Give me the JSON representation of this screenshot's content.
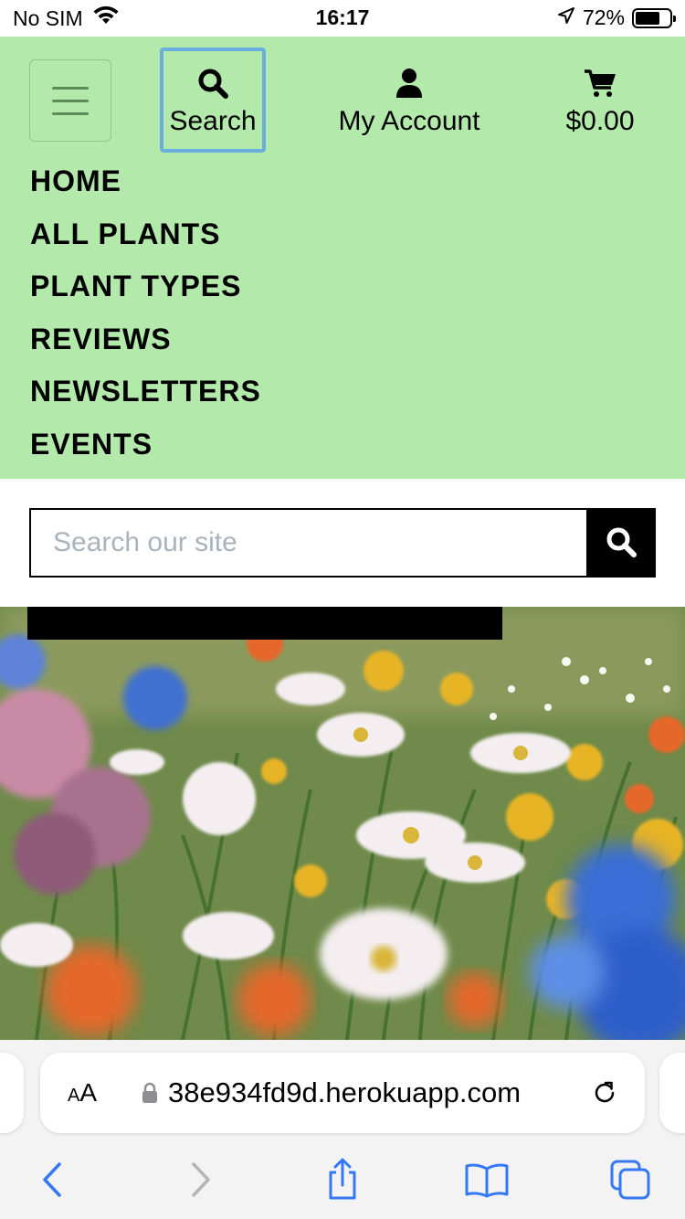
{
  "status_bar": {
    "carrier": "No SIM",
    "time": "16:17",
    "battery_percent": "72%",
    "battery_level": 0.72,
    "icons": [
      "wifi-icon",
      "location-arrow-icon",
      "battery-icon"
    ]
  },
  "header": {
    "background_color": "#b3e9aa",
    "search_label": "Search",
    "account_label": "My Account",
    "cart_total": "$0.00",
    "icons": [
      "hamburger-icon",
      "search-icon",
      "user-icon",
      "cart-icon"
    ]
  },
  "nav": {
    "items": [
      "HOME",
      "ALL PLANTS",
      "PLANT TYPES",
      "REVIEWS",
      "NEWSLETTERS",
      "EVENTS"
    ]
  },
  "search": {
    "placeholder": "Search our site",
    "submit_icon": "search-icon"
  },
  "hero": {
    "image": "wildflower meadow"
  },
  "safari": {
    "text_size_label": "AA",
    "url": "38e934fd9d.herokuapp.com",
    "accent_color": "#3478f6",
    "icons": [
      "lock-icon",
      "reload-icon",
      "back-icon",
      "forward-icon",
      "share-icon",
      "bookmarks-icon",
      "tabs-icon"
    ]
  }
}
